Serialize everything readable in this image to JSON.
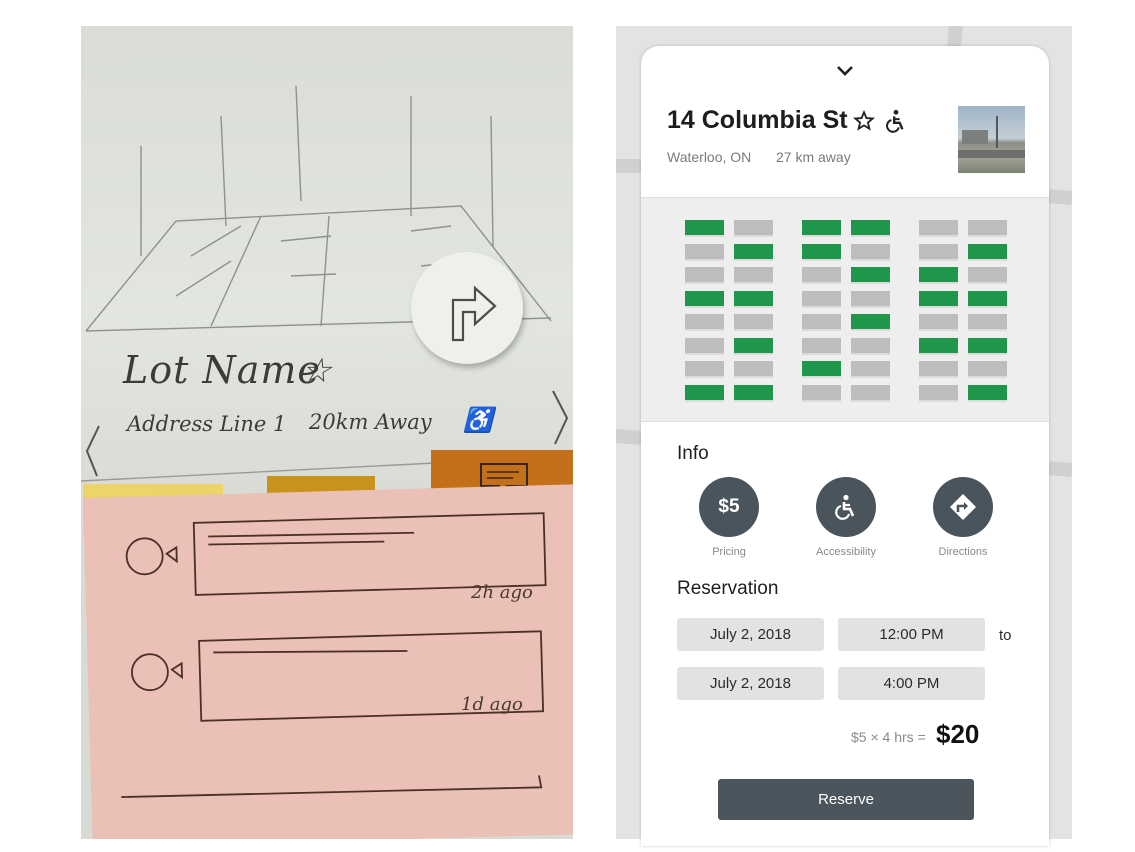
{
  "sketch": {
    "lot_name": "Lot Name",
    "star": "☆",
    "address": "Address Line 1",
    "distance": "20km Away",
    "access_symbol": "♿",
    "comments": [
      {
        "time": "2h ago"
      },
      {
        "time": "1d ago"
      }
    ]
  },
  "header": {
    "collapse_icon": "chevron-down-icon",
    "title": "14 Columbia St",
    "city": "Waterloo, ON",
    "distance": "27 km away"
  },
  "lot_map": {
    "free_color": "#20964a",
    "occupied_color": "#bdbdbd",
    "columns": [
      [
        [
          1,
          0
        ],
        [
          0,
          1
        ],
        [
          0,
          0
        ],
        [
          1,
          1
        ],
        [
          0,
          0
        ],
        [
          0,
          1
        ],
        [
          0,
          0
        ],
        [
          1,
          1
        ]
      ],
      [
        [
          1,
          1
        ],
        [
          1,
          0
        ],
        [
          0,
          1
        ],
        [
          0,
          0
        ],
        [
          0,
          1
        ],
        [
          0,
          0
        ],
        [
          1,
          0
        ],
        [
          0,
          0
        ]
      ],
      [
        [
          0,
          0
        ],
        [
          0,
          1
        ],
        [
          1,
          0
        ],
        [
          1,
          1
        ],
        [
          0,
          0
        ],
        [
          1,
          1
        ],
        [
          0,
          0
        ],
        [
          0,
          1
        ]
      ]
    ]
  },
  "info": {
    "title": "Info",
    "pricing_value": "$5",
    "pricing_label": "Pricing",
    "accessibility_label": "Accessibility",
    "directions_label": "Directions"
  },
  "reservation": {
    "title": "Reservation",
    "start_date": "July 2, 2018",
    "start_time": "12:00 PM",
    "to_label": "to",
    "end_date": "July 2, 2018",
    "end_time": "4:00 PM",
    "calc": "$5 × 4 hrs =",
    "total": "$20",
    "reserve_label": "Reserve"
  },
  "colors": {
    "button": "#4a555e",
    "free_spot": "#20964a"
  }
}
